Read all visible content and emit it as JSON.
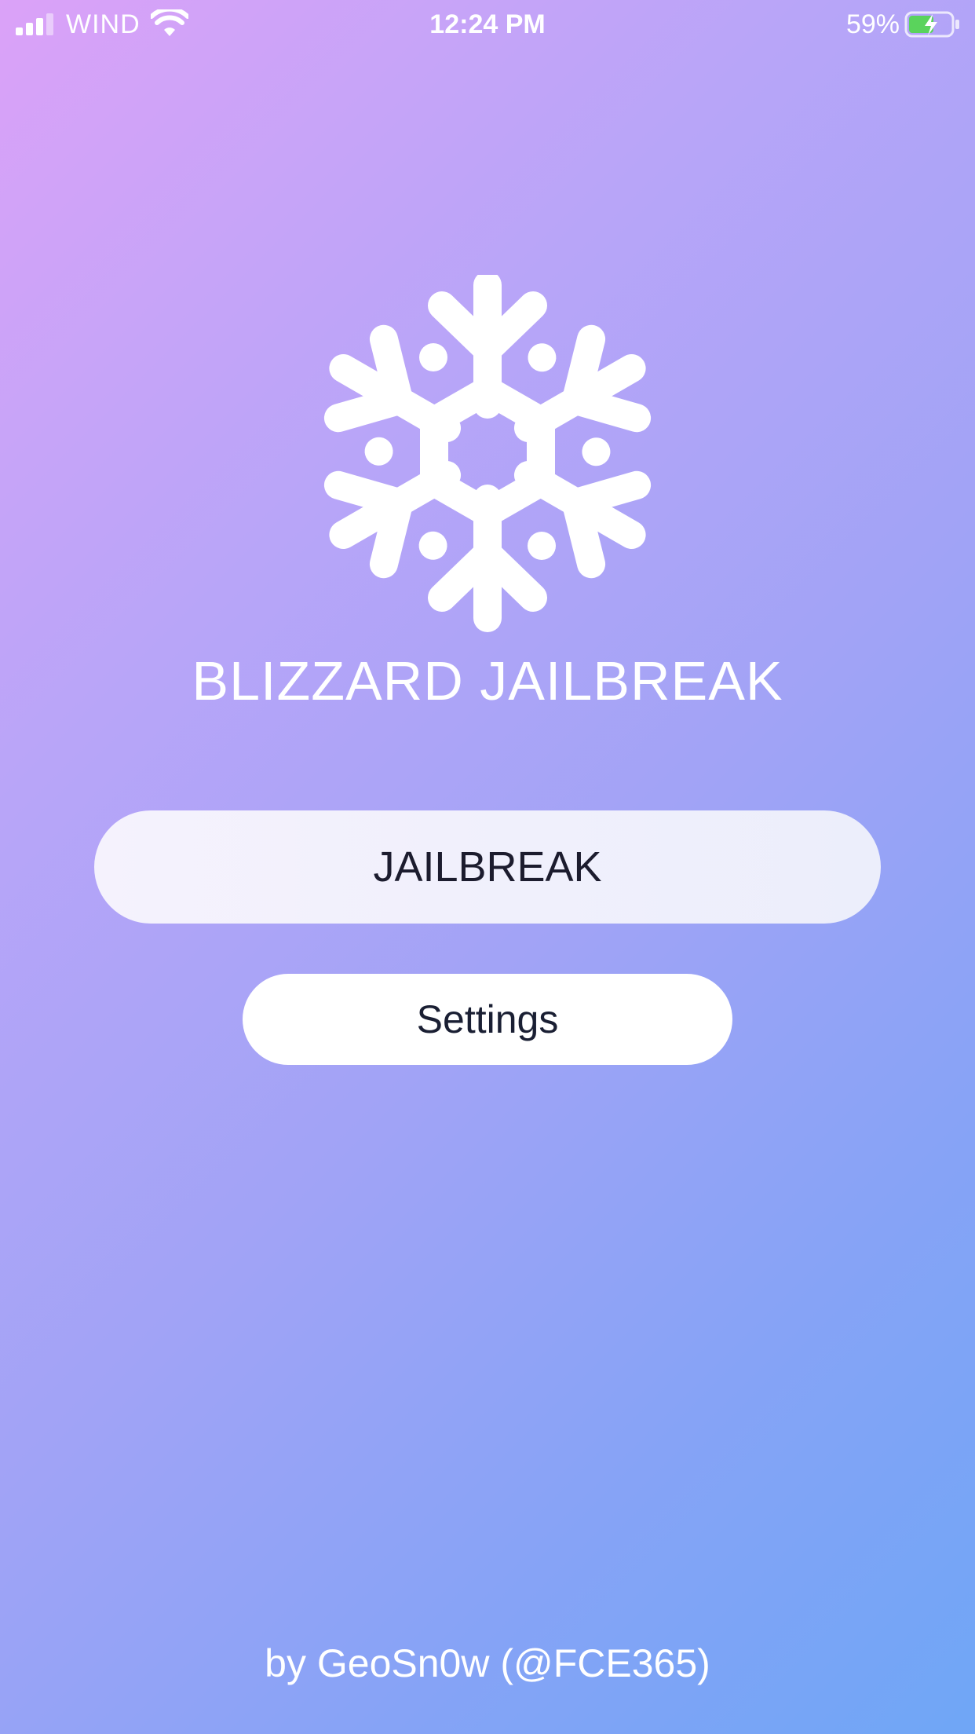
{
  "status_bar": {
    "carrier": "WIND",
    "time": "12:24 PM",
    "battery_percent": "59%",
    "battery_level": 0.59,
    "charging": true,
    "battery_fill_color": "#5ad35c",
    "signal_bars": 4,
    "signal_bars_active": 3
  },
  "logo": {
    "icon": "snowflake-icon"
  },
  "app": {
    "title": "BLIZZARD JAILBREAK"
  },
  "buttons": {
    "jailbreak_label": "JAILBREAK",
    "settings_label": "Settings"
  },
  "footer": {
    "credit": "by GeoSn0w (@FCE365)"
  },
  "colors": {
    "gradient_start": "#dba2f8",
    "gradient_end": "#6fa6f6",
    "text": "#ffffff",
    "button_text": "#1c1c2e"
  }
}
